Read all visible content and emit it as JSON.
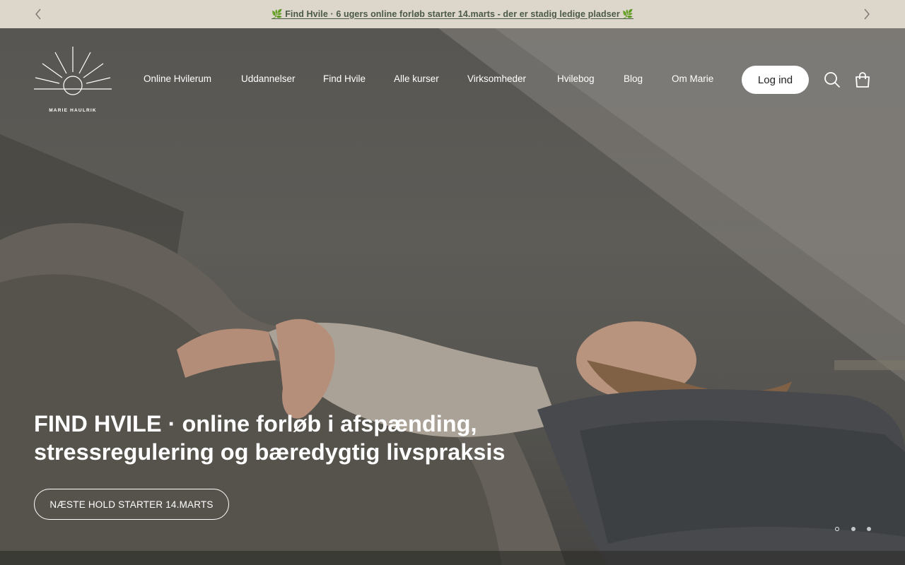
{
  "announcement": {
    "text": "🌿 Find Hvile · 6 ugers online forløb starter 14.marts - der er stadig ledige pladser 🌿",
    "prev_icon": "chevron-left-icon",
    "next_icon": "chevron-right-icon"
  },
  "header": {
    "logo_text": "MARIE HAULRIK",
    "nav": [
      {
        "label": "Online Hvilerum"
      },
      {
        "label": "Uddannelser"
      },
      {
        "label": "Find Hvile"
      },
      {
        "label": "Alle kurser"
      },
      {
        "label": "Virksomheder"
      },
      {
        "label": "Hvilebog"
      },
      {
        "label": "Blog"
      },
      {
        "label": "Om Marie"
      }
    ],
    "login_label": "Log ind",
    "search_icon": "search-icon",
    "cart_icon": "shopping-bag-icon"
  },
  "hero": {
    "title_line1": "FIND HVILE · online forløb i afspænding,",
    "title_line2": "stressregulering og bæredygtig livspraksis",
    "cta_label": "NÆSTE HOLD STARTER 14.MARTS",
    "slides_total": 3,
    "active_slide": 1
  },
  "colors": {
    "announcement_bg": "#dcd6cb",
    "announcement_text": "#4b5a45",
    "white": "#ffffff"
  }
}
